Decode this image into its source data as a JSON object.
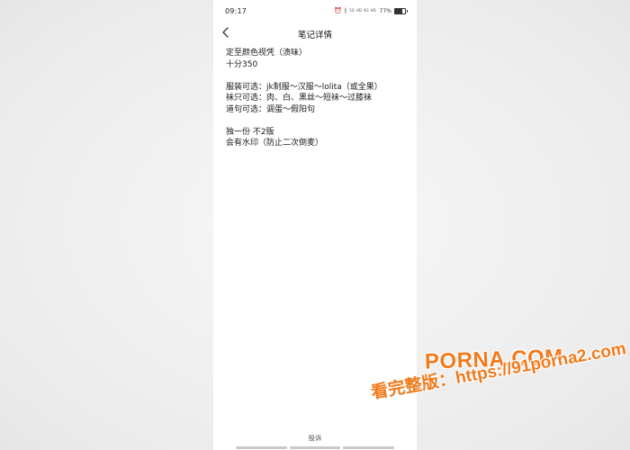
{
  "status_bar": {
    "time": "09:17",
    "indicators": [
      "alarm-icon",
      "bluetooth-icon"
    ],
    "tiny_labels": [
      "5G",
      "HD",
      "4G",
      "HD"
    ],
    "battery_text": "77%",
    "battery_level": 0.77
  },
  "header": {
    "title": "笔记详情"
  },
  "note": {
    "lines": [
      "定至颜色视凭（渍味）",
      "十分350",
      "",
      "服装可选：jk制服～汉服～lolita（或全果）",
      "袜只可选：肉、白、黑丝～短袜～过膝袜",
      "道句可选：调蛋～假阳句",
      "",
      "独一份 不2贩",
      "会有水印（防止二次倒麦）"
    ]
  },
  "footer": {
    "complain_label": "投诉"
  },
  "watermark": {
    "logo": "PORNA.COM",
    "url": "看完整版：https://91porna2.com"
  },
  "colors": {
    "watermark": "#f07a1c",
    "background": "#ececec",
    "phone_bg": "#ffffff"
  }
}
